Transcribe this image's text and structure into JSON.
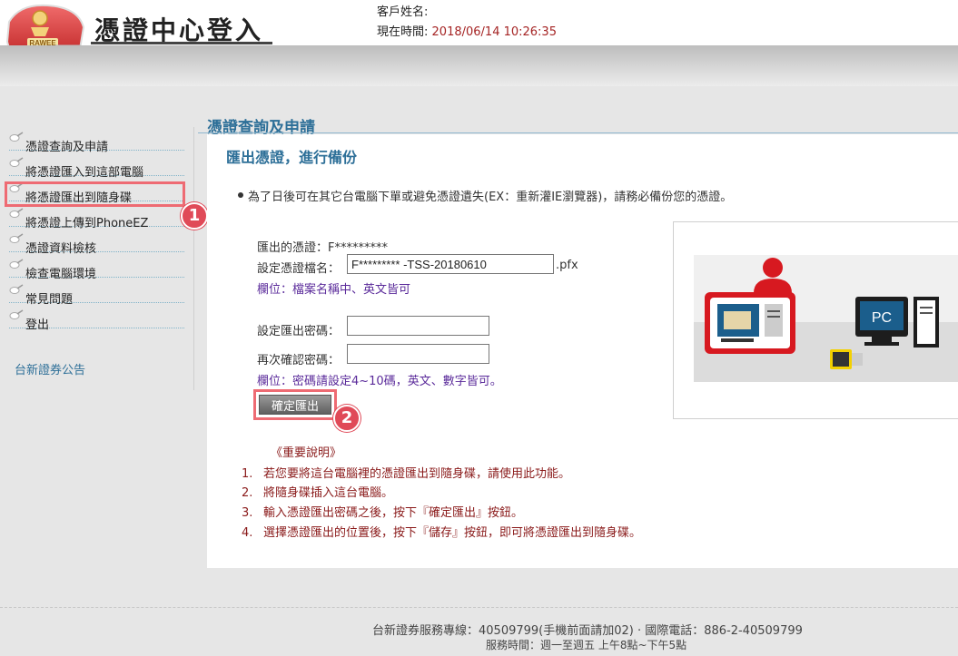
{
  "header": {
    "logo_text": "RAWEE",
    "app_title": "憑證中心登入",
    "customer_label": "客戶姓名:",
    "time_label": "現在時間:",
    "time_value": "2018/06/14 10:26:35"
  },
  "sidebar": {
    "items": [
      {
        "label": "憑證查詢及申請"
      },
      {
        "label": "將憑證匯入到這部電腦"
      },
      {
        "label": "將憑證匯出到隨身碟"
      },
      {
        "label": "將憑證上傳到PhoneEZ"
      },
      {
        "label": "憑證資料檢核"
      },
      {
        "label": "檢查電腦環境"
      },
      {
        "label": "常見問題"
      },
      {
        "label": "登出"
      }
    ],
    "news_link": "台新證券公告"
  },
  "badges": {
    "first": "1",
    "second": "2"
  },
  "main": {
    "section_title": "憑證查詢及申請",
    "panel_title": "匯出憑證，進行備份",
    "intro": "為了日後可在其它台電腦下單或避免憑證遺失(EX：重新灌IE瀏覽器)，請務必備份您的憑證。",
    "form": {
      "cert_label": "匯出的憑證：",
      "cert_value": "F*********",
      "filename_label": "設定憑證檔名：",
      "filename_value": "F********* -TSS-20180610",
      "filename_ext": ".pfx",
      "filename_hint": "欄位：檔案名稱中、英文皆可",
      "password_label": "設定匯出密碼：",
      "password_value": "",
      "confirm_label": "再次確認密碼：",
      "confirm_value": "",
      "password_hint": "欄位：密碼請設定4~10碼，英文、數字皆可。",
      "submit_label": "確定匯出"
    },
    "illustration": {
      "pc_label": "PC"
    },
    "notes": {
      "title": "《重要說明》",
      "items": [
        {
          "num": "1.",
          "text": "若您要將這台電腦裡的憑證匯出到隨身碟，請使用此功能。"
        },
        {
          "num": "2.",
          "text": "將隨身碟插入這台電腦。"
        },
        {
          "num": "3.",
          "text": "輸入憑證匯出密碼之後，按下『確定匯出』按鈕。"
        },
        {
          "num": "4.",
          "text": "選擇憑證匯出的位置後，按下『儲存』按鈕，即可將憑證匯出到隨身碟。"
        }
      ]
    }
  },
  "footer": {
    "line1": "台新證券服務專線：40509799(手機前面請加02) · 國際電話：886-2-40509799",
    "line2": "服務時間：週一至週五 上午8點~下午5點"
  },
  "colors": {
    "accent_blue": "#2d6f98",
    "highlight_red": "#ee6b73",
    "note_red": "#8a1a1a",
    "hint_purple": "#5a2a9a"
  }
}
